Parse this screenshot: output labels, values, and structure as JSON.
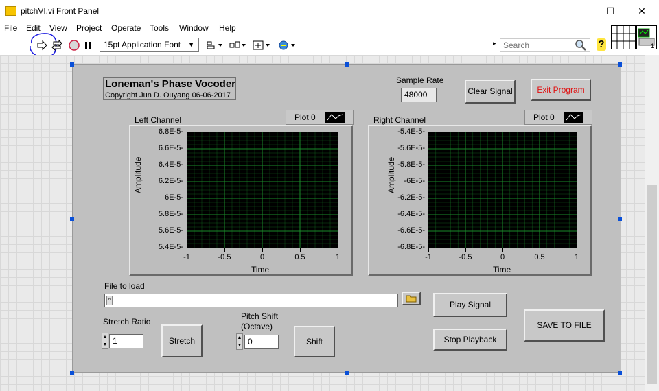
{
  "window": {
    "title": "pitchVI.vi Front Panel",
    "min": "—",
    "max": "☐",
    "close": "✕"
  },
  "menu": [
    "File",
    "Edit",
    "View",
    "Project",
    "Operate",
    "Tools",
    "Window",
    "Help"
  ],
  "toolbar": {
    "font": "15pt Application Font",
    "search_placeholder": "Search",
    "help": "?"
  },
  "panel": {
    "title": "Loneman's Phase Vocoder",
    "copyright": "Copyright Jun D. Ouyang 06-06-2017",
    "sample_rate_label": "Sample Rate",
    "sample_rate_value": "48000",
    "clear_signal": "Clear Signal",
    "exit_program": "Exit Program",
    "file_to_load_label": "File to load",
    "play_signal": "Play Signal",
    "stop_playback": "Stop Playback",
    "save_to_file": "SAVE TO FILE",
    "stretch_ratio_label": "Stretch Ratio",
    "stretch_ratio_value": "1",
    "stretch_button": "Stretch",
    "pitch_shift_label_1": "Pitch Shift",
    "pitch_shift_label_2": "(Octave)",
    "pitch_shift_value": "0",
    "shift_button": "Shift",
    "plot_colors": {
      "background": "#000000",
      "grid": "#1a8a2a"
    }
  },
  "chart_data": [
    {
      "type": "line",
      "title": "Left Channel",
      "legend": "Plot 0",
      "xlabel": "Time",
      "ylabel": "Amplitude",
      "xlim": [
        -1,
        1
      ],
      "ylim": [
        5.4e-05,
        6.8e-05
      ],
      "x_ticks": [
        "-1",
        "-0.5",
        "0",
        "0.5",
        "1"
      ],
      "y_ticks": [
        "6.8E-5",
        "6.6E-5",
        "6.4E-5",
        "6.2E-5",
        "6E-5",
        "5.8E-5",
        "5.6E-5",
        "5.4E-5"
      ],
      "series": []
    },
    {
      "type": "line",
      "title": "Right Channel",
      "legend": "Plot 0",
      "xlabel": "Time",
      "ylabel": "Amplitude",
      "xlim": [
        -1,
        1
      ],
      "ylim": [
        -6.8e-05,
        -5.4e-05
      ],
      "x_ticks": [
        "-1",
        "-0.5",
        "0",
        "0.5",
        "1"
      ],
      "y_ticks": [
        "-5.4E-5",
        "-5.6E-5",
        "-5.8E-5",
        "-6E-5",
        "-6.2E-5",
        "-6.4E-5",
        "-6.6E-5",
        "-6.8E-5"
      ],
      "series": []
    }
  ]
}
